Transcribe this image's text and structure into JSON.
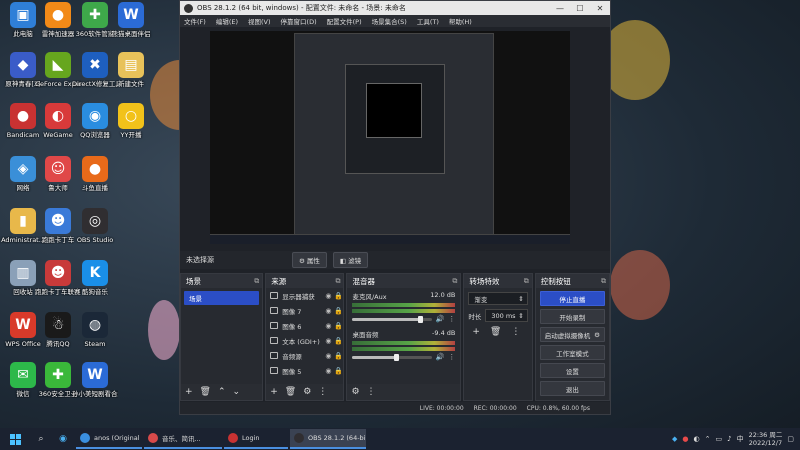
{
  "desktop": {
    "icons": [
      {
        "label": "此电脑",
        "glyph": "▣",
        "color": "#2f7fd8"
      },
      {
        "label": "雷神加速器",
        "glyph": "●",
        "color": "#f28a18"
      },
      {
        "label": "360软件管家",
        "glyph": "✚",
        "color": "#3ea84a"
      },
      {
        "label": "熊猫桌面伴侣",
        "glyph": "W",
        "color": "#2b6bd6"
      },
      {
        "label": "原神青春[3]",
        "glyph": "◆",
        "color": "#3a5cc8"
      },
      {
        "label": "GeForce Experience",
        "glyph": "◣",
        "color": "#66a61e"
      },
      {
        "label": "DirectX修复工具",
        "glyph": "✖",
        "color": "#1e5fbf"
      },
      {
        "label": "新建文件",
        "glyph": "▤",
        "color": "#e8c25a"
      },
      {
        "label": "Bandicam",
        "glyph": "●",
        "color": "#c83232"
      },
      {
        "label": "WeGame",
        "glyph": "◐",
        "color": "#d83a3a"
      },
      {
        "label": "QQ浏览器",
        "glyph": "◉",
        "color": "#2a8de0"
      },
      {
        "label": "YY开播",
        "glyph": "○",
        "color": "#f2c21a"
      },
      {
        "label": "网络",
        "glyph": "◈",
        "color": "#3a8fd8"
      },
      {
        "label": "鲁大师",
        "glyph": "☺",
        "color": "#e04848"
      },
      {
        "label": "斗鱼直播",
        "glyph": "●",
        "color": "#e86a1a"
      },
      {
        "label": "Administrat...",
        "glyph": "▮",
        "color": "#e8b84a"
      },
      {
        "label": "跑跑卡丁车",
        "glyph": "☻",
        "color": "#3a7ad8"
      },
      {
        "label": "OBS Studio",
        "glyph": "◎",
        "color": "#302e31"
      },
      {
        "label": "回收站",
        "glyph": "▥",
        "color": "#8aa0b8"
      },
      {
        "label": "跑跑卡丁车联赛版",
        "glyph": "☻",
        "color": "#c83a3a"
      },
      {
        "label": "酷狗音乐",
        "glyph": "K",
        "color": "#1a8fe8"
      },
      {
        "label": "WPS Office",
        "glyph": "W",
        "color": "#d83a2a"
      },
      {
        "label": "腾讯QQ",
        "glyph": "☃",
        "color": "#1a1a1a"
      },
      {
        "label": "Steam",
        "glyph": "◍",
        "color": "#1b2838"
      },
      {
        "label": "微信",
        "glyph": "✉",
        "color": "#2db84a"
      },
      {
        "label": "360安全卫士",
        "glyph": "✚",
        "color": "#3ab83a"
      },
      {
        "label": "孙小美短剧看合集",
        "glyph": "W",
        "color": "#2b6bd6"
      }
    ]
  },
  "obs": {
    "title": "OBS 28.1.2 (64 bit, windows) - 配置文件: 未命名 - 场景: 未命名",
    "menu": [
      "文件(F)",
      "编辑(E)",
      "视图(V)",
      "停靠窗口(D)",
      "配置文件(P)",
      "场景集合(S)",
      "工具(T)",
      "帮助(H)"
    ],
    "no_source": "未选择源",
    "properties_btn": "属性",
    "filters_btn": "滤镜",
    "scenes": {
      "title": "场景",
      "items": [
        "场景"
      ]
    },
    "sources": {
      "title": "来源",
      "items": [
        "显示器捕获",
        "图像 7",
        "图像 6",
        "文本 (GDI+)",
        "音频源",
        "图像 5"
      ]
    },
    "mixer": {
      "title": "混音器",
      "channels": [
        {
          "name": "麦克风/Aux",
          "db": "12.0 dB",
          "level": 0.85
        },
        {
          "name": "桌面音频",
          "db": "-9.4 dB",
          "level": 0.55
        }
      ]
    },
    "transitions": {
      "title": "转场特效",
      "type": "渐变",
      "duration_label": "时长",
      "duration_value": "300 ms"
    },
    "controls": {
      "title": "控制按钮",
      "buttons": [
        "停止直播",
        "开始录制",
        "启动虚拟摄像机",
        "工作室模式",
        "设置",
        "退出"
      ]
    },
    "status": {
      "live": "LIVE: 00:00:00",
      "rec": "REC: 00:00:00",
      "cpu": "CPU: 0.8%, 60.00 fps"
    }
  },
  "taskbar": {
    "tasks": [
      {
        "label": "anos (Original Mi...",
        "color": "#3a8fe0",
        "active": false
      },
      {
        "label": "音乐、简讯...",
        "color": "#d84a4a",
        "active": false
      },
      {
        "label": "Login",
        "color": "#c83232",
        "active": false
      },
      {
        "label": "OBS 28.1.2 (64-bi...",
        "color": "#302e31",
        "active": true
      }
    ],
    "time": "22:36 周二",
    "date": "2022/12/7"
  }
}
